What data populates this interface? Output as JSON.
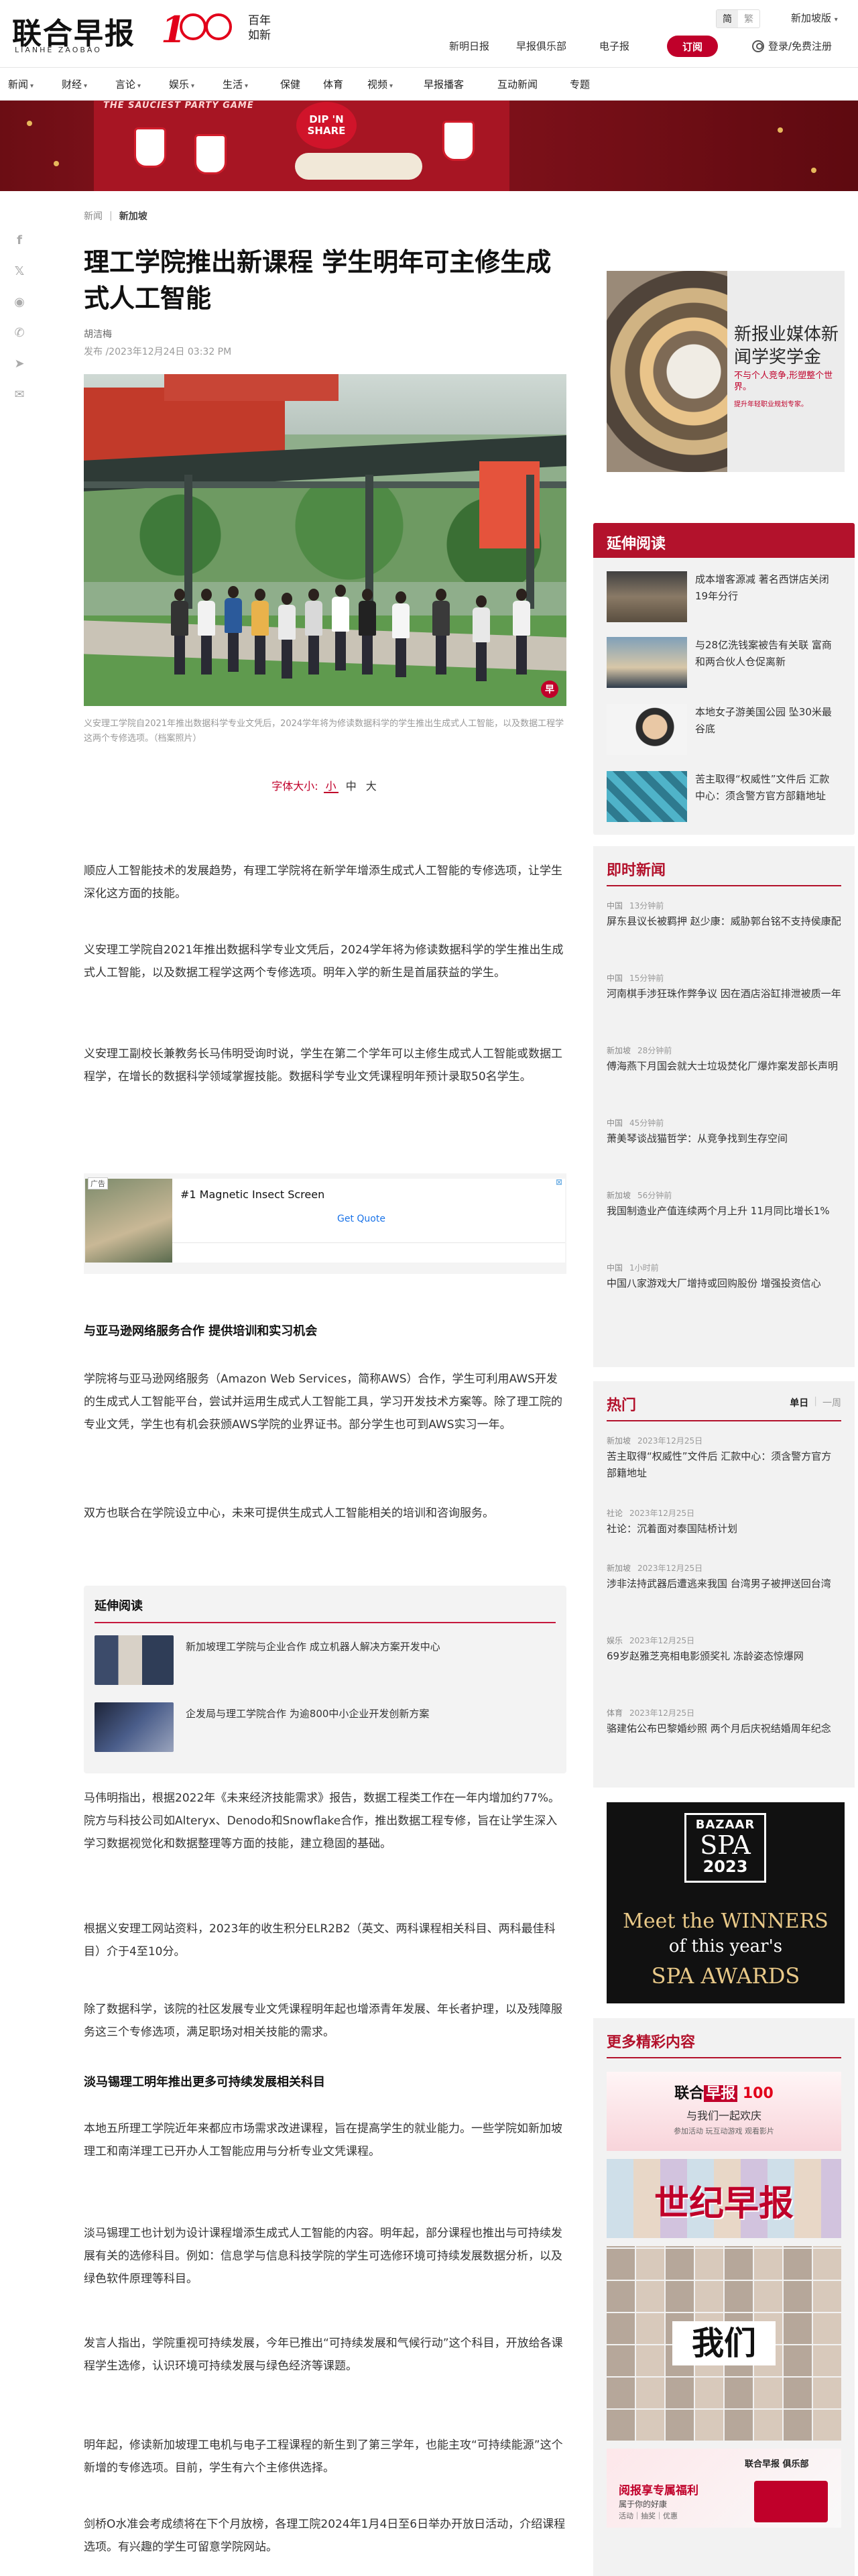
{
  "header": {
    "logo_cn": "联合早报",
    "logo_en": "LIANHE ZAOBAO",
    "logo_100": "100",
    "logo_baini_1": "百年",
    "logo_baini_2": "如新",
    "lang_simplified": "简",
    "lang_traditional": "繁",
    "region": "新加坡版",
    "links": [
      "新明日报",
      "早报俱乐部",
      "电子报"
    ],
    "subscribe": "订阅",
    "login": "登录/免费注册"
  },
  "nav": {
    "items": [
      {
        "label": "新闻",
        "caret": true
      },
      {
        "label": "财经",
        "caret": true
      },
      {
        "label": "言论",
        "caret": true
      },
      {
        "label": "娱乐",
        "caret": true
      },
      {
        "label": "生活",
        "caret": true
      },
      {
        "label": "保健",
        "caret": false
      },
      {
        "label": "体育",
        "caret": false
      },
      {
        "label": "视频",
        "caret": true
      },
      {
        "label": "早报播客",
        "caret": false
      },
      {
        "label": "互动新闻",
        "caret": false
      },
      {
        "label": "专题",
        "caret": false
      }
    ]
  },
  "banner": {
    "tag": "THE SAUCIEST PARTY GAME",
    "sign": "DIP 'N SHARE"
  },
  "breadcrumb": {
    "root": "新闻",
    "current": "新加坡"
  },
  "article": {
    "title": "理工学院推出新课程 学生明年可主修生成式人工智能",
    "author": "胡洁梅",
    "date": "发布 /2023年12月24日 03:32 PM",
    "caption": "义安理工学院自2021年推出数据科学专业文凭后，2024学年将为修读数据科学的学生推出生成式人工智能，以及数据工程学这两个专修选项。（档案照片）",
    "font_label": "字体大小:",
    "font_options": [
      "小",
      "中",
      "大"
    ],
    "paras": [
      "顺应人工智能技术的发展趋势，有理工学院将在新学年增添生成式人工智能的专修选项，让学生深化这方面的技能。",
      "义安理工学院自2021年推出数据科学专业文凭后，2024学年将为修读数据科学的学生推出生成式人工智能，以及数据工程学这两个专修选项。明年入学的新生是首届获益的学生。",
      "义安理工副校长兼教务长马伟明受询时说，学生在第二个学年可以主修生成式人工智能或数据工程学，在增长的数据科学领域掌握技能。数据科学专业文凭课程明年预计录取50名学生。",
      "学院将与亚马逊网络服务（Amazon Web Services，简称AWS）合作，学生可利用AWS开发的生成式人工智能平台，尝试并运用生成式人工智能工具，学习开发技术方案等。除了理工院的专业文凭，学生也有机会获颁AWS学院的业界证书。部分学生也可到AWS实习一年。",
      "双方也联合在学院设立中心，未来可提供生成式人工智能相关的培训和咨询服务。",
      "马伟明指出，根据2022年《未来经济技能需求》报告，数据工程类工作在一年内增加约77%。院方与科技公司如Alteryx、Denodo和Snowflake合作，推出数据工程专修，旨在让学生深入学习数据视觉化和数据整理等方面的技能，建立稳固的基础。",
      "根据义安理工网站资料，2023年的收生积分ELR2B2（英文、两科课程相关科目、两科最佳科目）介于4至10分。",
      "除了数据科学，该院的社区发展专业文凭课程明年起也增添青年发展、年长者护理，以及残障服务这三个专修选项，满足职场对相关技能的需求。",
      "本地五所理工学院近年来都应市场需求改进课程，旨在提高学生的就业能力。一些学院如新加坡理工和南洋理工已开办人工智能应用与分析专业文凭课程。",
      "淡马锡理工也计划为设计课程增添生成式人工智能的内容。明年起，部分课程也推出与可持续发展有关的选修科目。例如：信息学与信息科技学院的学生可选修环境可持续发展数据分析，以及绿色软件原理等科目。",
      "发言人指出，学院重视可持续发展，今年已推出“可持续发展和气候行动”这个科目，开放给各课程学生选修，认识环境可持续发展与绿色经济等课题。",
      "明年起，修读新加坡理工电机与电子工程课程的新生到了第三学年，也能主攻“可持续能源”这个新增的专修选项。目前，学生有六个主修供选择。",
      "剑桥O水准会考成绩将在下个月放榜，各理工院2024年1月4日至6日举办开放日活动，介绍课程选项。有兴趣的学生可留意学院网站。"
    ],
    "subhead1": "与亚马逊网络服务合作 提供培训和实习机会",
    "subhead2": "淡马锡理工明年推出更多可持续发展相关科目"
  },
  "inline_ad": {
    "label": "广告",
    "close": "⊠",
    "title": "#1 Magnetic Insect Screen",
    "cta": "Get Quote"
  },
  "related_inline": {
    "title": "延伸阅读",
    "items": [
      "新加坡理工学院与企业合作 成立机器人解决方案开发中心",
      "企发局与理工学院合作 为逾800中小企业开发创新方案"
    ]
  },
  "promo": {
    "title": "新报业媒体新闻学奖学金",
    "sub": "不与个人竞争,形塑整个世界。",
    "foot": "提升年轻职业规划专家。"
  },
  "sidebar": {
    "related_title": "延伸阅读",
    "related": [
      "成本增客源减 著名西饼店关闭19年分行",
      "与28亿洗钱案被告有关联 富商和两合伙人仓促离新",
      "本地女子游美国公园 坠30米最谷底",
      "苦主取得“权威性”文件后 汇款中心：须含警方官方部籍地址"
    ],
    "instant_title": "即时新闻",
    "instant": [
      {
        "cat": "中国",
        "time": "13分钟前",
        "text": "屏东县议长被羁押 赵少康：威胁郭台铭不支持侯康配"
      },
      {
        "cat": "中国",
        "time": "15分钟前",
        "text": "河南棋手涉狂珠作弊争议 因在酒店浴缸排泄被质一年"
      },
      {
        "cat": "新加坡",
        "time": "28分钟前",
        "text": "傅海燕下月国会就大士垃圾焚化厂爆炸案发部长声明"
      },
      {
        "cat": "中国",
        "time": "45分钟前",
        "text": "萧美琴谈战猫哲学：从竞争找到生存空间"
      },
      {
        "cat": "新加坡",
        "time": "56分钟前",
        "text": "我国制造业产值连续两个月上升 11月同比增长1%"
      },
      {
        "cat": "中国",
        "time": "1小时前",
        "text": "中国八家游戏大厂增持或回购股份 增强投资信心"
      }
    ],
    "hot_title": "热门",
    "hot_tab_day": "单日",
    "hot_tab_week": "一周",
    "hot": [
      {
        "cat": "新加坡",
        "time": "2023年12月25日",
        "text": "苦主取得“权威性”文件后 汇款中心：须含警方官方部籍地址"
      },
      {
        "cat": "社论",
        "time": "2023年12月25日",
        "text": "社论：沉着面对泰国陆桥计划"
      },
      {
        "cat": "新加坡",
        "time": "2023年12月25日",
        "text": "涉非法持武器后遭逃来我国 台湾男子被押送回台湾"
      },
      {
        "cat": "娱乐",
        "time": "2023年12月25日",
        "text": "69岁赵雅芝亮相电影颁奖礼 冻龄姿态惊爆网"
      },
      {
        "cat": "体育",
        "time": "2023年12月25日",
        "text": "骆建佑公布巴黎婚纱照 两个月后庆祝结婚周年纪念"
      }
    ],
    "spa_ad": {
      "b1": "BAZAAR",
      "b2": "SPA",
      "b3": "2023",
      "meet": "Meet the WINNERS",
      "ofy": "of this year's",
      "spa": "SPA AWARDS"
    },
    "more_title": "更多精彩内容",
    "more_tile1_l1_a": "联合",
    "more_tile1_l1_b": "早报",
    "more_tile1_l1_c": "100",
    "more_tile1_l2": "与我们一起欢庆",
    "more_tile1_l3": "参加活动 玩互动游戏 观看影片",
    "more_tile2": "世纪早报",
    "more_tile3": "我们",
    "more_tile4_logo": "联合早报 俱乐部",
    "more_tile4_l1": "阅报享专属福利",
    "more_tile4_l2": "属于你的好康",
    "more_tile4_l3": "活动｜抽奖｜优惠"
  }
}
